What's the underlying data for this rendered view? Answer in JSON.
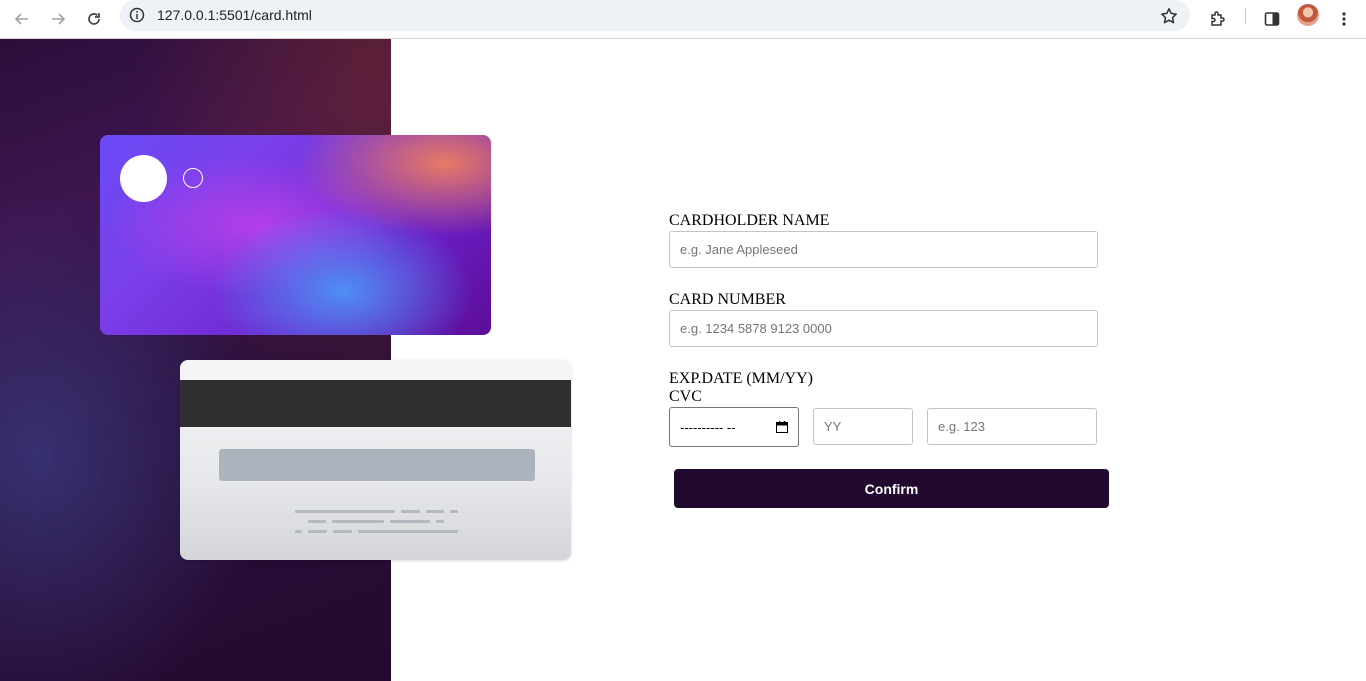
{
  "browser": {
    "url": "127.0.0.1:5501/card.html"
  },
  "icons": {
    "back": "arrow-left-icon",
    "forward": "arrow-right-icon",
    "reload": "reload-icon",
    "site_info": "info-icon",
    "bookmark": "star-icon",
    "extensions": "puzzle-icon",
    "side_panel": "side-panel-icon",
    "menu": "kebab-menu-icon"
  },
  "form": {
    "name_label": "CARDHOLDER NAME",
    "name_placeholder": "e.g. Jane Appleseed",
    "number_label": "CARD NUMBER",
    "number_placeholder": "e.g. 1234 5878 9123 0000",
    "exp_label": "EXP.DATE (MM/YY)",
    "cvc_label": "CVC",
    "date_value": "----------  --",
    "year_placeholder": "YY",
    "cvc_placeholder": "e.g. 123",
    "confirm_label": "Confirm"
  },
  "colors": {
    "confirm_bg": "#21092f",
    "panel_bg": "#2a0f3b"
  }
}
